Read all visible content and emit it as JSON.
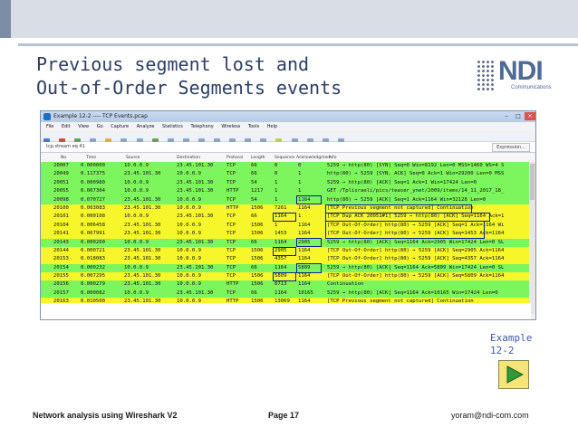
{
  "slide": {
    "title_line1": "Previous segment lost and",
    "title_line2": "Out-of-Order Segments events",
    "logo_text": "NDI",
    "logo_sub": "Communications",
    "example_line1": "Example",
    "example_line2": "12-2",
    "footer_left": "Network analysis using Wireshark V2",
    "footer_center": "Page 17",
    "footer_right": "yoram@ndi-com.com"
  },
  "window": {
    "title": "Example 12-2 ---- TCP Events.pcap",
    "controls": [
      "–",
      "□",
      "✕"
    ],
    "menu": [
      "File",
      "Edit",
      "View",
      "Go",
      "Capture",
      "Analyze",
      "Statistics",
      "Telephony",
      "Wireless",
      "Tools",
      "Help"
    ],
    "filter": "tcp.stream eq 41",
    "expression_label": "Expression...",
    "columns": [
      "No.",
      "Time",
      "Source",
      "Destination",
      "Protocol",
      "Length",
      "Sequence",
      "Acknowledgment",
      "Info"
    ]
  },
  "colors": {
    "green": "#7df55c",
    "yellow": "#f6f62a",
    "box": "#0a1f8f",
    "title": "#2c3e63",
    "accent": "#4f6a96"
  },
  "packets": [
    {
      "no": "20007",
      "time": "0.000000",
      "src": "10.0.0.9",
      "dst": "23.45.101.30",
      "proto": "TCP",
      "len": "66",
      "seq": "0",
      "ack": "0",
      "info": "5259 → http(80) [SYN] Seq=0 Win=8192 Len=0 MSS=1460 WS=4 S",
      "color": "green"
    },
    {
      "no": "20049",
      "time": "0.117375",
      "src": "23.45.101.30",
      "dst": "10.0.0.9",
      "proto": "TCP",
      "len": "66",
      "seq": "0",
      "ack": "1",
      "info": "http(80) → 5259 [SYN, ACK] Seq=0 Ack=1 Win=29200 Len=0 MSS",
      "color": "green"
    },
    {
      "no": "20051",
      "time": "0.000980",
      "src": "10.0.0.9",
      "dst": "23.45.101.30",
      "proto": "TCP",
      "len": "54",
      "seq": "1",
      "ack": "1",
      "info": "5259 → http(80) [ACK] Seq=1 Ack=1 Win=17424 Len=0",
      "color": "green"
    },
    {
      "no": "20055",
      "time": "0.007304",
      "src": "10.0.0.9",
      "dst": "23.45.101.30",
      "proto": "HTTP",
      "len": "1217",
      "seq": "1",
      "ack": "1",
      "info": "GET /Tplisraeli/pics/teaser_ynet/2009/items/14_11_2017_18_",
      "color": "green"
    },
    {
      "no": "20098",
      "time": "0.070727",
      "src": "23.45.101.30",
      "dst": "10.0.0.9",
      "proto": "TCP",
      "len": "54",
      "seq": "1",
      "ack": "1164",
      "info": "http(80) → 5259 [ACK] Seq=1 Ack=1164 Win=32128 Len=0",
      "color": "green"
    },
    {
      "no": "20100",
      "time": "0.003083",
      "src": "23.45.101.30",
      "dst": "10.0.0.9",
      "proto": "HTTP",
      "len": "1506",
      "seq": "7261",
      "ack": "1164",
      "info": "[TCP Previous segment not captured] Continuation",
      "color": "yellow"
    },
    {
      "no": "20101",
      "time": "0.000108",
      "src": "10.0.0.9",
      "dst": "23.45.101.30",
      "proto": "TCP",
      "len": "66",
      "seq": "1164",
      "ack": "1",
      "info": "[TCP Dup ACK 20051#1] 5259 → http(80) [ACK] Seq=1164 Ack=1",
      "color": "yellow"
    },
    {
      "no": "20104",
      "time": "0.006458",
      "src": "23.45.101.30",
      "dst": "10.0.0.9",
      "proto": "TCP",
      "len": "1506",
      "seq": "1",
      "ack": "1164",
      "info": "[TCP Out-Of-Order] http(80) → 5259 [ACK] Seq=1 Ack=1164 Wi",
      "color": "yellow"
    },
    {
      "no": "20141",
      "time": "0.067991",
      "src": "23.45.101.30",
      "dst": "10.0.0.9",
      "proto": "TCP",
      "len": "1506",
      "seq": "1453",
      "ack": "1164",
      "info": "[TCP Out-Of-Order] http(80) → 5259 [ACK] Seq=1453 Ack=1164",
      "color": "yellow"
    },
    {
      "no": "20143",
      "time": "0.000260",
      "src": "10.0.0.9",
      "dst": "23.45.101.30",
      "proto": "TCP",
      "len": "66",
      "seq": "1164",
      "ack": "2905",
      "info": "5259 → http(80) [ACK] Seq=1164 Ack=2905 Win=17424 Len=0 SL",
      "color": "green"
    },
    {
      "no": "20144",
      "time": "0.000721",
      "src": "23.45.101.30",
      "dst": "10.0.0.9",
      "proto": "TCP",
      "len": "1506",
      "seq": "2905",
      "ack": "1164",
      "info": "[TCP Out-Of-Order] http(80) → 5259 [ACK] Seq=2905 Ack=1164",
      "color": "yellow"
    },
    {
      "no": "20153",
      "time": "0.018083",
      "src": "23.45.101.30",
      "dst": "10.0.0.9",
      "proto": "TCP",
      "len": "1506",
      "seq": "4357",
      "ack": "1164",
      "info": "[TCP Out-Of-Order] http(80) → 5259 [ACK] Seq=4357 Ack=1164",
      "color": "yellow"
    },
    {
      "no": "20154",
      "time": "0.000232",
      "src": "10.0.0.9",
      "dst": "23.45.101.30",
      "proto": "TCP",
      "len": "66",
      "seq": "1164",
      "ack": "5809",
      "info": "5259 → http(80) [ACK] Seq=1164 Ack=5809 Win=17424 Len=0 SL",
      "color": "green"
    },
    {
      "no": "20155",
      "time": "0.007295",
      "src": "23.45.101.30",
      "dst": "10.0.0.9",
      "proto": "TCP",
      "len": "1506",
      "seq": "5809",
      "ack": "1164",
      "info": "[TCP Out-Of-Order] http(80) → 5259 [ACK] Seq=5809 Ack=1164",
      "color": "yellow"
    },
    {
      "no": "20156",
      "time": "0.000279",
      "src": "23.45.101.30",
      "dst": "10.0.0.9",
      "proto": "HTTP",
      "len": "1506",
      "seq": "8713",
      "ack": "1164",
      "info": "Continuation",
      "color": "green"
    },
    {
      "no": "20157",
      "time": "0.000082",
      "src": "10.0.0.9",
      "dst": "23.45.101.30",
      "proto": "TCP",
      "len": "66",
      "seq": "1164",
      "ack": "10165",
      "info": "5259 → http(80) [ACK] Seq=1164 Ack=10165 Win=17424 Len=0",
      "color": "green"
    },
    {
      "no": "20163",
      "time": "0.010500",
      "src": "23.45.101.30",
      "dst": "10.0.0.9",
      "proto": "HTTP",
      "len": "1506",
      "seq": "13069",
      "ack": "1164",
      "info": "[TCP Previous segment not captured] Continuation",
      "color": "yellow"
    }
  ]
}
